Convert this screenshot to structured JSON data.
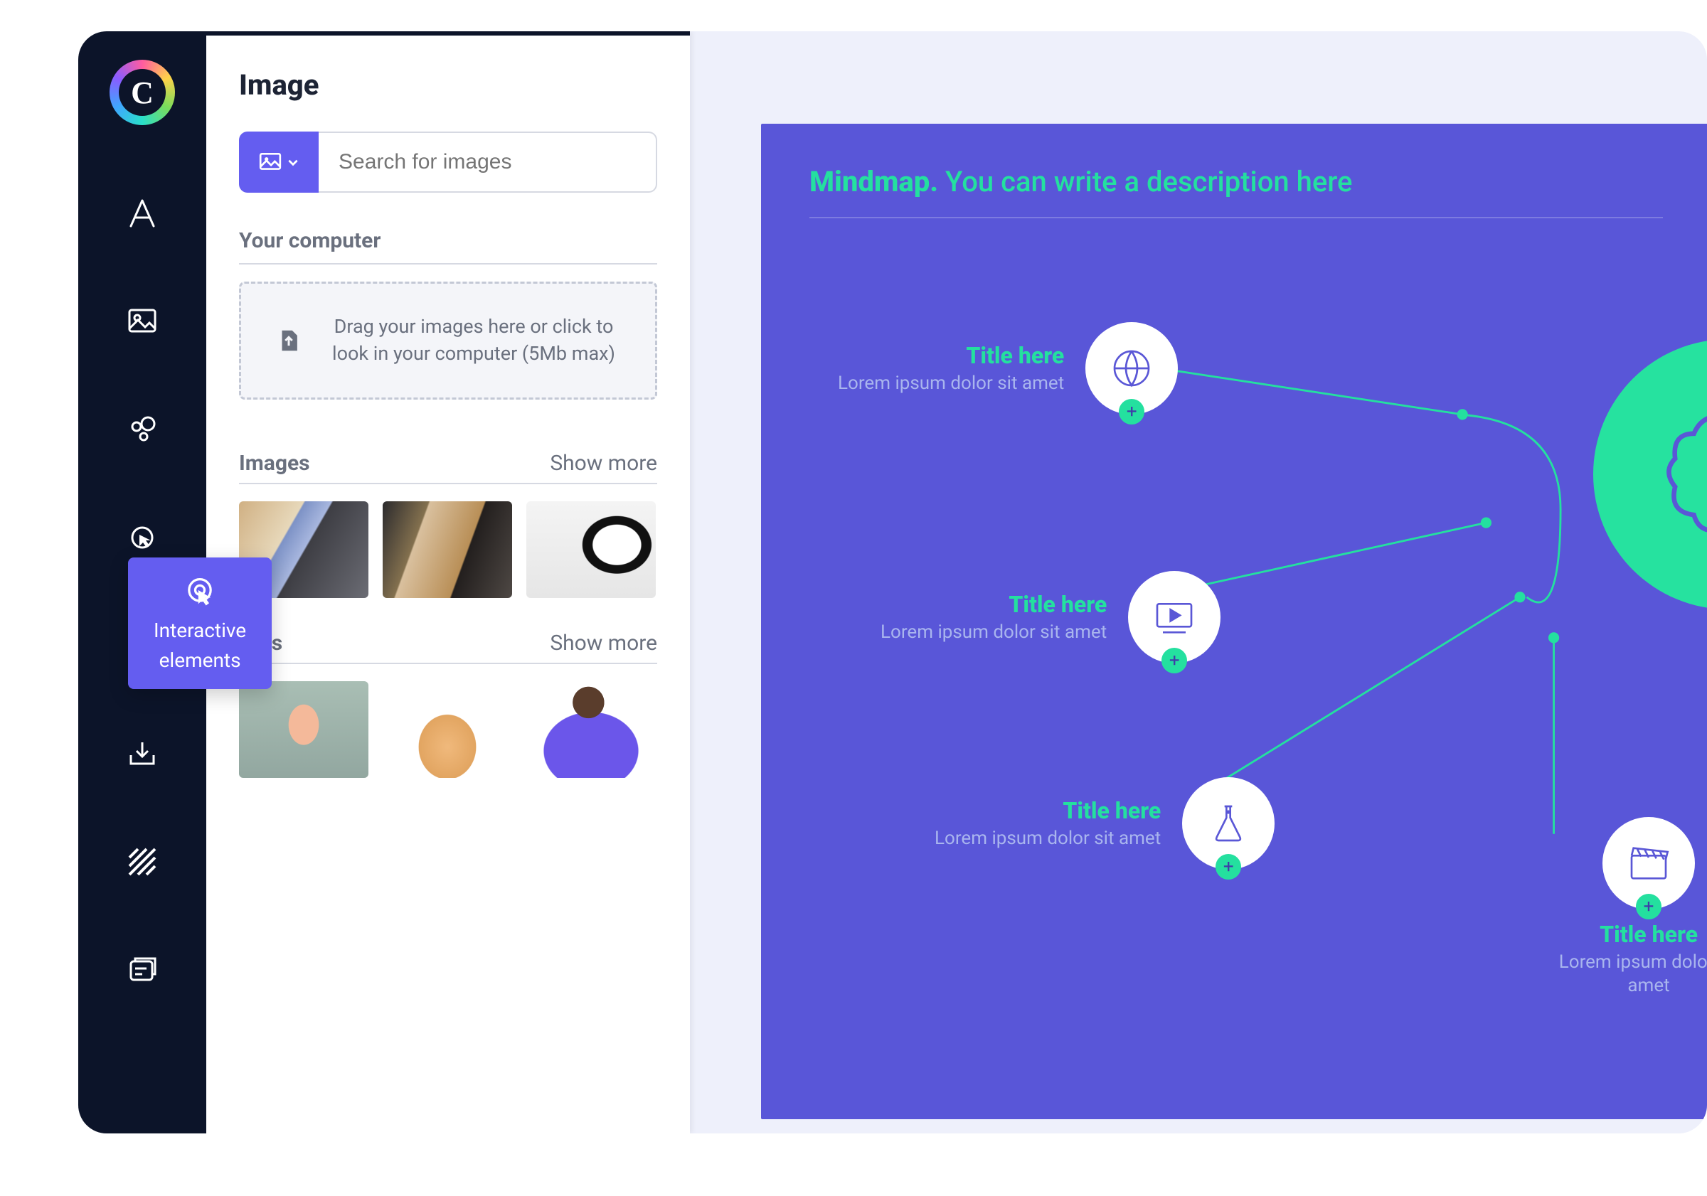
{
  "sidebar": {
    "logo_letter": "C",
    "items": [
      {
        "name": "text-tool",
        "glyph": "A"
      },
      {
        "name": "image-tool",
        "glyph": "image"
      },
      {
        "name": "resources-tool",
        "glyph": "bubbles"
      },
      {
        "name": "interactive-tool",
        "glyph": "cursor"
      },
      {
        "name": "layout-tool",
        "glyph": "layout"
      },
      {
        "name": "insert-tool",
        "glyph": "inbox"
      },
      {
        "name": "background-tool",
        "glyph": "hatch"
      },
      {
        "name": "pages-tool",
        "glyph": "pages"
      }
    ],
    "tooltip": {
      "line1": "Interactive",
      "line2": "elements"
    }
  },
  "panel": {
    "title": "Image",
    "search_placeholder": "Search for images",
    "sections": {
      "your_computer": "Your computer",
      "dropzone": "Drag your images here or click to look in your computer (5Mb max)",
      "images": "Images",
      "gifs": "GIFs",
      "show_more": "Show more"
    }
  },
  "slide": {
    "heading_bold": "Mindmap.",
    "heading_rest": " You can write a description here",
    "node_title": "Title here",
    "node_sub": "Lorem ipsum dolor sit amet"
  }
}
